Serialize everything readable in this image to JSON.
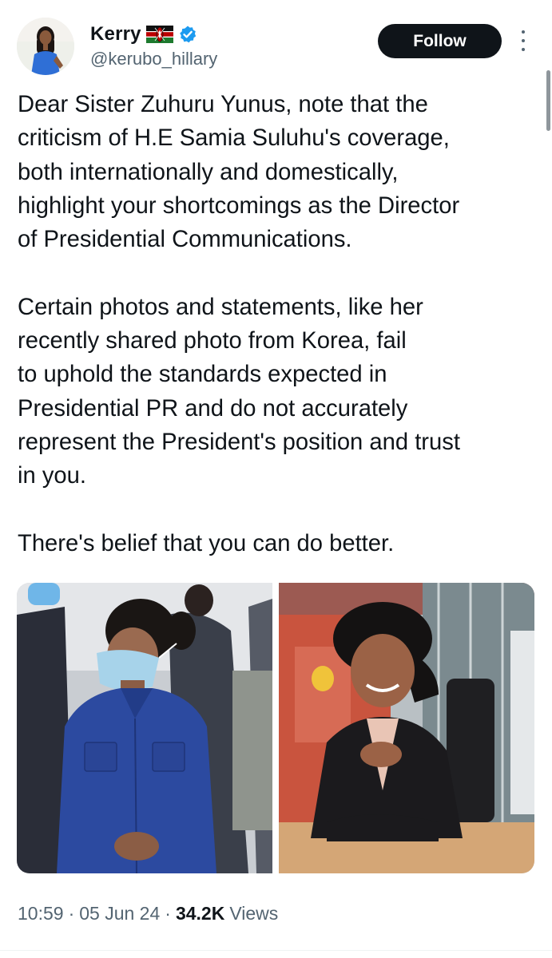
{
  "author": {
    "display_name": "Kerry",
    "flag_icon": "kenya-flag-icon",
    "verified_icon": "verified-badge-icon",
    "handle": "@kerubo_hillary"
  },
  "actions": {
    "follow_label": "Follow",
    "more_icon": "more-options-icon"
  },
  "tweet": {
    "paragraphs": [
      {
        "lines": [
          "Dear Sister Zuhuru Yunus, note that the",
          "criticism of H.E Samia Suluhu's coverage,",
          "both internationally and domestically,",
          "highlight your shortcomings as the Director",
          "of Presidential Communications."
        ]
      },
      {
        "lines": [
          "Certain photos and statements, like her",
          "recently shared photo from Korea, fail",
          "to uphold the standards expected in",
          "Presidential PR and do not accurately",
          "represent the President's position and trust",
          "in you."
        ]
      },
      {
        "lines": [
          "There's belief that you can do better."
        ]
      }
    ]
  },
  "media": {
    "photo_left": "photo-woman-in-blue-with-face-mask",
    "photo_right": "photo-woman-in-black-smiling-at-desk"
  },
  "meta": {
    "time": "10:59",
    "separator": "·",
    "date": "05 Jun 24",
    "views_count": "34.2K",
    "views_label": "Views"
  },
  "colors": {
    "text_primary": "#0f1419",
    "text_secondary": "#536471",
    "verified_blue": "#1d9bf0",
    "follow_button_bg": "#0f1419"
  }
}
